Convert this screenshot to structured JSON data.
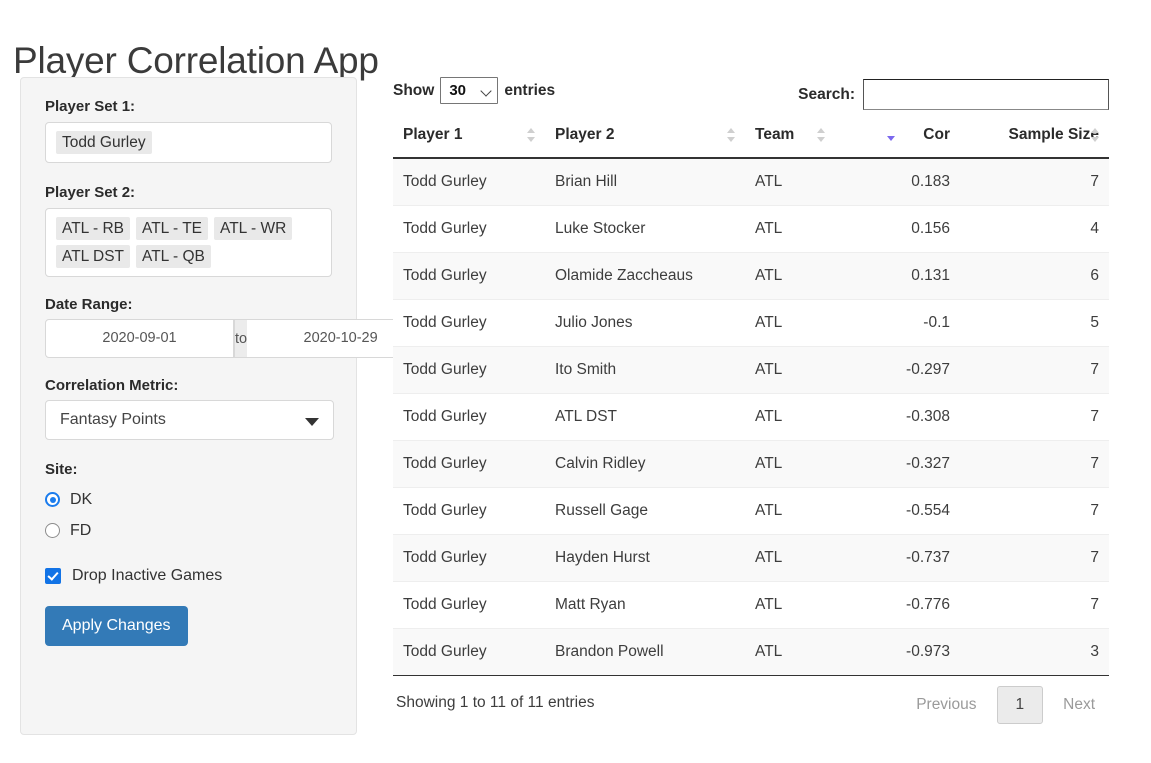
{
  "app": {
    "title": "Player Correlation App"
  },
  "sidebar": {
    "player_set_1": {
      "label": "Player Set 1:",
      "chips": [
        "Todd Gurley"
      ]
    },
    "player_set_2": {
      "label": "Player Set 2:",
      "chips": [
        "ATL - RB",
        "ATL - TE",
        "ATL - WR",
        "ATL DST",
        "ATL - QB"
      ]
    },
    "date_range": {
      "label": "Date Range:",
      "start": "2020-09-01",
      "separator": "to",
      "end": "2020-10-29"
    },
    "correlation_metric": {
      "label": "Correlation Metric:",
      "value": "Fantasy Points",
      "caret_icon": "caret-down-icon"
    },
    "site": {
      "label": "Site:",
      "options": [
        {
          "label": "DK",
          "selected": true
        },
        {
          "label": "FD",
          "selected": false
        }
      ]
    },
    "drop_inactive": {
      "label": "Drop Inactive Games",
      "checked": true
    },
    "apply_button": "Apply Changes"
  },
  "table_controls": {
    "show_label": "Show",
    "entries_label": "entries",
    "page_length": "30",
    "page_length_chevron_icon": "chevron-down-icon",
    "search_label": "Search:",
    "search_value": "",
    "search_placeholder": ""
  },
  "table": {
    "columns": [
      {
        "label": "Player 1",
        "align": "left",
        "sort": "none"
      },
      {
        "label": "Player 2",
        "align": "left",
        "sort": "none"
      },
      {
        "label": "Team",
        "align": "left",
        "sort": "none"
      },
      {
        "label": "Cor",
        "align": "right",
        "sort": "desc"
      },
      {
        "label": "Sample Size",
        "align": "right",
        "sort": "none"
      }
    ],
    "rows": [
      {
        "player1": "Todd Gurley",
        "player2": "Brian Hill",
        "team": "ATL",
        "cor": "0.183",
        "sample": "7"
      },
      {
        "player1": "Todd Gurley",
        "player2": "Luke Stocker",
        "team": "ATL",
        "cor": "0.156",
        "sample": "4"
      },
      {
        "player1": "Todd Gurley",
        "player2": "Olamide Zaccheaus",
        "team": "ATL",
        "cor": "0.131",
        "sample": "6"
      },
      {
        "player1": "Todd Gurley",
        "player2": "Julio Jones",
        "team": "ATL",
        "cor": "-0.1",
        "sample": "5"
      },
      {
        "player1": "Todd Gurley",
        "player2": "Ito Smith",
        "team": "ATL",
        "cor": "-0.297",
        "sample": "7"
      },
      {
        "player1": "Todd Gurley",
        "player2": "ATL DST",
        "team": "ATL",
        "cor": "-0.308",
        "sample": "7"
      },
      {
        "player1": "Todd Gurley",
        "player2": "Calvin Ridley",
        "team": "ATL",
        "cor": "-0.327",
        "sample": "7"
      },
      {
        "player1": "Todd Gurley",
        "player2": "Russell Gage",
        "team": "ATL",
        "cor": "-0.554",
        "sample": "7"
      },
      {
        "player1": "Todd Gurley",
        "player2": "Hayden Hurst",
        "team": "ATL",
        "cor": "-0.737",
        "sample": "7"
      },
      {
        "player1": "Todd Gurley",
        "player2": "Matt Ryan",
        "team": "ATL",
        "cor": "-0.776",
        "sample": "7"
      },
      {
        "player1": "Todd Gurley",
        "player2": "Brandon Powell",
        "team": "ATL",
        "cor": "-0.973",
        "sample": "3"
      }
    ]
  },
  "footer": {
    "info": "Showing 1 to 11 of 11 entries",
    "previous": "Previous",
    "current_page": "1",
    "next": "Next"
  },
  "colors": {
    "primary_button": "#337ab7",
    "accent_checkbox": "#1273e6",
    "accent_radio": "#1b7ced",
    "active_sort_arrow": "#7b68ee",
    "panel_background": "#f5f5f5",
    "row_stripe": "#f9f9f9"
  }
}
